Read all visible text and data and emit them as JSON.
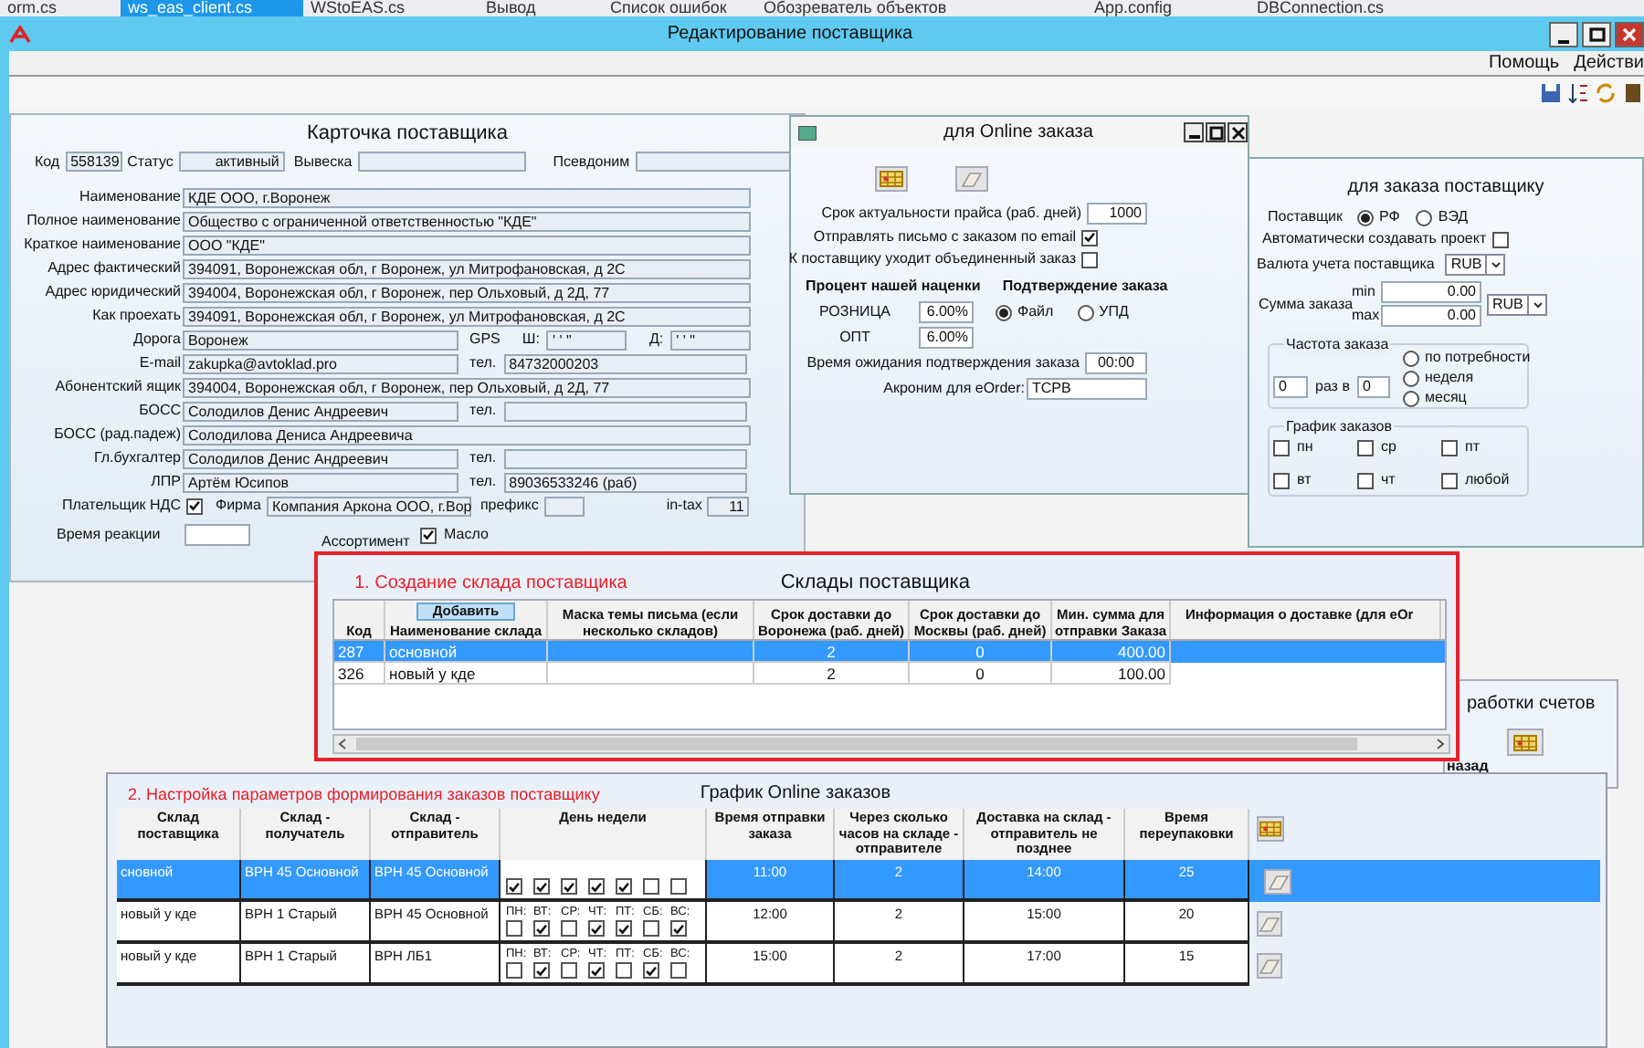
{
  "ide_tabs": [
    {
      "label": "orm.cs",
      "selected": false
    },
    {
      "label": "ws_eas_client.cs",
      "selected": true
    },
    {
      "label": "WStoEAS.cs",
      "selected": false
    },
    {
      "label": "Вывод",
      "selected": false
    },
    {
      "label": "Список ошибок",
      "selected": false
    },
    {
      "label": "Обозреватель объектов",
      "selected": false
    },
    {
      "label": "App.config",
      "selected": false
    },
    {
      "label": "DBConnection.cs",
      "selected": false
    }
  ],
  "window": {
    "title": "Редактирование поставщика"
  },
  "menu": [
    "Помощь",
    "Действи"
  ],
  "supplier_card": {
    "title": "Карточка поставщика",
    "header": [
      {
        "label": "Код",
        "value": "558139"
      },
      {
        "label": "Статус",
        "value": "активный"
      },
      {
        "label": "Вывеска"
      },
      {
        "label": "Псевдоним"
      }
    ],
    "fields": [
      {
        "label": "Наименование",
        "value": "КДЕ ООО, г.Воронеж"
      },
      {
        "label": "Полное наименование",
        "value": "Общество с ограниченной ответственностью \"КДЕ\""
      },
      {
        "label": "Краткое наименование",
        "value": "ООО \"КДЕ\""
      },
      {
        "label": "Адрес фактический",
        "value": "394091, Воронежская обл, г Воронеж, ул Митрофановская, д 2С"
      },
      {
        "label": "Адрес юридический",
        "value": "394004, Воронежская обл, г Воронеж, пер Ольховый, д 2Д,  77"
      },
      {
        "label": "Как проехать",
        "value": "394091, Воронежская обл, г Воронеж, ул Митрофановская, д 2С"
      },
      {
        "label": "Дорога",
        "value": "Воронеж",
        "side": [
          {
            "label": "GPS"
          },
          {
            "label": "Ш:",
            "value": "' '  \""
          },
          {
            "label": "Д:",
            "value": "' '  \""
          }
        ]
      },
      {
        "label": "E-mail",
        "value": "zakupka@avtoklad.pro",
        "side": [
          {
            "label": "тел.",
            "value": "84732000203"
          }
        ]
      },
      {
        "label": "Абонентский ящик",
        "value": "394004, Воронежская обл, г Воронеж, пер Ольховый, д 2Д,  77"
      },
      {
        "label": "БОСС",
        "value": "Солодилов Денис Андреевич",
        "side": [
          {
            "label": "тел."
          }
        ]
      },
      {
        "label": "БОСС (рад.падеж)",
        "value": "Солодилова Дениса Андреевича"
      },
      {
        "label": "Гл.бухгалтер",
        "value": "Солодилов Денис Андреевич",
        "side": [
          {
            "label": "тел."
          }
        ]
      },
      {
        "label": "ЛПР",
        "value": "Артём Юсипов",
        "side": [
          {
            "label": "тел.",
            "value": "89036533246 (раб)"
          }
        ]
      }
    ],
    "vat_payer": {
      "label": "Плательщик НДС",
      "checked": true
    },
    "firm": {
      "label": "Фирма",
      "value": "Компания Аркона ООО, г.Вор"
    },
    "prefix": {
      "label": "префикс"
    },
    "in_tax": {
      "label": "in-tax",
      "value": "11"
    },
    "reaction_time": {
      "label": "Время реакции"
    },
    "oil": {
      "label": "Масло",
      "checked": true
    },
    "assortment": {
      "label": "Ассортимент"
    }
  },
  "online_order": {
    "title": "для Online заказа",
    "price_days": {
      "label": "Срок актуальности прайса (раб. дней)",
      "value": "1000"
    },
    "checks": [
      {
        "label": "Отправлять письмо с заказом по email",
        "checked": true
      },
      {
        "label": "К поставщику уходит объединенный заказ",
        "checked": false
      }
    ],
    "markup": {
      "title": "Процент нашей наценки",
      "rows": [
        {
          "label": "РОЗНИЦА",
          "value": "6.00%"
        },
        {
          "label": "ОПТ",
          "value": "6.00%"
        }
      ]
    },
    "confirmation": {
      "title": "Подтверждение заказа",
      "options": [
        {
          "label": "Файл",
          "selected": true
        },
        {
          "label": "УПД",
          "selected": false
        }
      ]
    },
    "wait_time": {
      "label": "Время ожидания подтверждения заказа",
      "value": "00:00"
    },
    "acronym": {
      "label": "Акроним для eOrder:",
      "value": "ТСРВ"
    }
  },
  "supplier_order": {
    "title": "для заказа поставщику",
    "supplier_type": {
      "label": "Поставщик",
      "options": [
        {
          "label": "РФ",
          "selected": true
        },
        {
          "label": "ВЭД",
          "selected": false
        }
      ]
    },
    "auto_project": {
      "label": "Автоматически создавать проект",
      "checked": false
    },
    "currency": {
      "label": "Валюта учета поставщика",
      "value": "RUB"
    },
    "order_sum": {
      "label": "Сумма заказа",
      "min_label": "min",
      "min": "0.00",
      "max_label": "max",
      "max": "0.00",
      "currency": "RUB"
    },
    "frequency": {
      "title": "Частота заказа",
      "count": "0",
      "per_label": "раз в",
      "per": "0",
      "options": [
        {
          "label": "по потребности",
          "selected": false
        },
        {
          "label": "неделя",
          "selected": false
        },
        {
          "label": "месяц",
          "selected": false
        }
      ]
    },
    "schedule": {
      "title": "График заказов",
      "days": [
        {
          "label": "пн",
          "checked": false
        },
        {
          "label": "ср",
          "checked": false
        },
        {
          "label": "пт",
          "checked": false
        },
        {
          "label": "вт",
          "checked": false
        },
        {
          "label": "чт",
          "checked": false
        },
        {
          "label": "любой",
          "checked": false
        }
      ]
    }
  },
  "invoice_panel": {
    "title": "работки счетов",
    "label": "назад"
  },
  "warehouses": {
    "step": "1. Создание склада поставщика",
    "title": "Склады поставщика",
    "add_button": "Добавить",
    "columns": [
      "Код",
      "Наименование склада",
      "Маска  темы письма (если несколько складов)",
      "Срок доставки до Воронежа (раб. дней)",
      "Срок доставки до Москвы (раб. дней)",
      "Мин. сумма для отправки Заказа",
      "Информация о доставке (для eOr"
    ],
    "rows": [
      {
        "code": "287",
        "name": "основной",
        "days_voronezh": "2",
        "days_moscow": "0",
        "min_sum": "400.00",
        "selected": true
      },
      {
        "code": "326",
        "name": "новый у кде",
        "days_voronezh": "2",
        "days_moscow": "0",
        "min_sum": "100.00",
        "selected": false
      }
    ]
  },
  "online_schedule": {
    "step": "2. Настройка параметров формирования заказов поставщику",
    "title": "График Online заказов",
    "columns": [
      "Склад поставщика",
      "Склад - получатель",
      "Склад - отправитель",
      "День недели",
      "Время отправки заказа",
      "Через сколько часов на складе - отправителе",
      "Доставка на склад - отправитель не позднее",
      "Время переупаковки"
    ],
    "rows": [
      {
        "selected": true,
        "supplier_wh": "сновной",
        "receiver": "ВРН 45 Основной",
        "sender": "ВРН 45 Основной",
        "days": [
          {
            "checked": true
          },
          {
            "checked": true
          },
          {
            "checked": true
          },
          {
            "checked": true
          },
          {
            "checked": true
          },
          {
            "checked": false
          },
          {
            "checked": false
          }
        ],
        "send_time": "11:00",
        "hours": "2",
        "deliver_by": "14:00",
        "repack": "25"
      },
      {
        "selected": false,
        "supplier_wh": "новый у кде",
        "receiver": "ВРН 1 Старый",
        "sender": "ВРН 45 Основной",
        "days": [
          {
            "label": "ПН:",
            "checked": false
          },
          {
            "label": "ВТ:",
            "checked": true
          },
          {
            "label": "СР:",
            "checked": false
          },
          {
            "label": "ЧТ:",
            "checked": true
          },
          {
            "label": "ПТ:",
            "checked": true
          },
          {
            "label": "СБ:",
            "checked": false
          },
          {
            "label": "ВС:",
            "checked": true
          }
        ],
        "send_time": "12:00",
        "hours": "2",
        "deliver_by": "15:00",
        "repack": "20"
      },
      {
        "selected": false,
        "supplier_wh": "новый у кде",
        "receiver": "ВРН 1 Старый",
        "sender": "ВРН ЛБ1",
        "days": [
          {
            "label": "ПН:",
            "checked": false
          },
          {
            "label": "ВТ:",
            "checked": true
          },
          {
            "label": "СР:",
            "checked": false
          },
          {
            "label": "ЧТ:",
            "checked": true
          },
          {
            "label": "ПТ:",
            "checked": false
          },
          {
            "label": "СБ:",
            "checked": true
          },
          {
            "label": "ВС:",
            "checked": false
          }
        ],
        "send_time": "15:00",
        "hours": "2",
        "deliver_by": "17:00",
        "repack": "15"
      }
    ]
  }
}
